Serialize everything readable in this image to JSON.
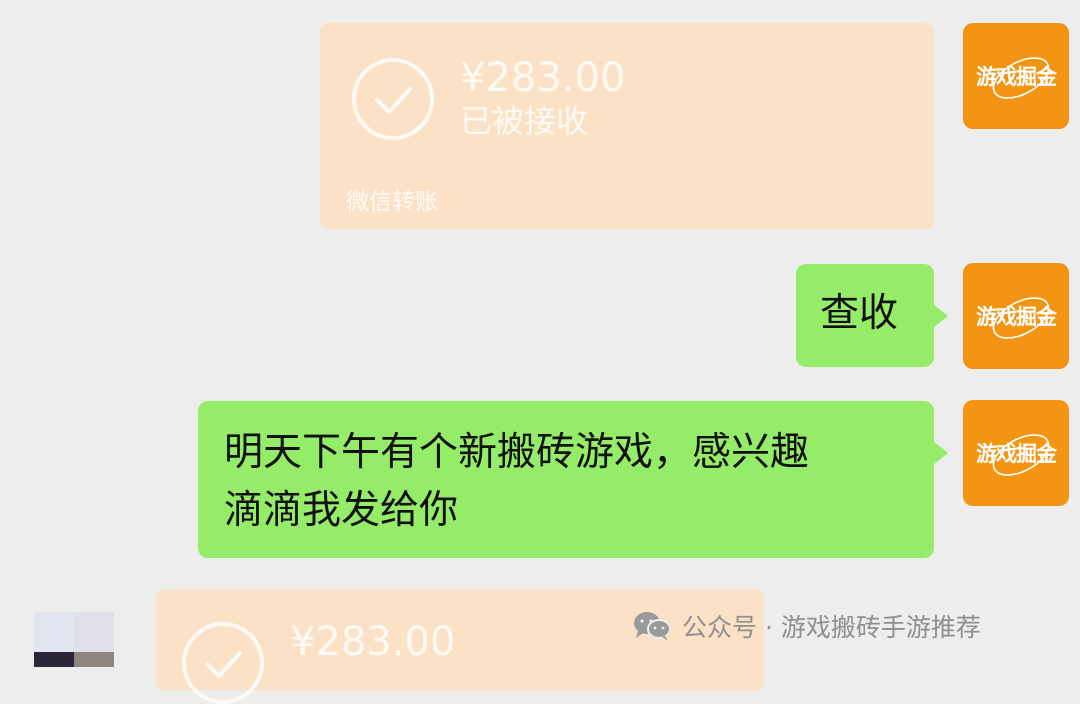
{
  "transfers": [
    {
      "amount": "¥283.00",
      "status": "已被接收",
      "label": "微信转账"
    },
    {
      "amount": "¥283.00"
    }
  ],
  "messages": [
    {
      "text": "查收"
    },
    {
      "lines": [
        "明天下午有个新搬砖游戏，感兴趣",
        "滴滴我发给你"
      ]
    }
  ],
  "avatar": {
    "logo_text": "游戏掘金",
    "icon": "brand-logo"
  },
  "watermark": {
    "text": "公众号 · 游戏搬砖手游推荐",
    "icon": "wechat-icon"
  },
  "colors": {
    "background": "#ededed",
    "sent_bubble": "#95ec69",
    "transfer_card": "#fbe2c7",
    "avatar": "#f39412"
  }
}
